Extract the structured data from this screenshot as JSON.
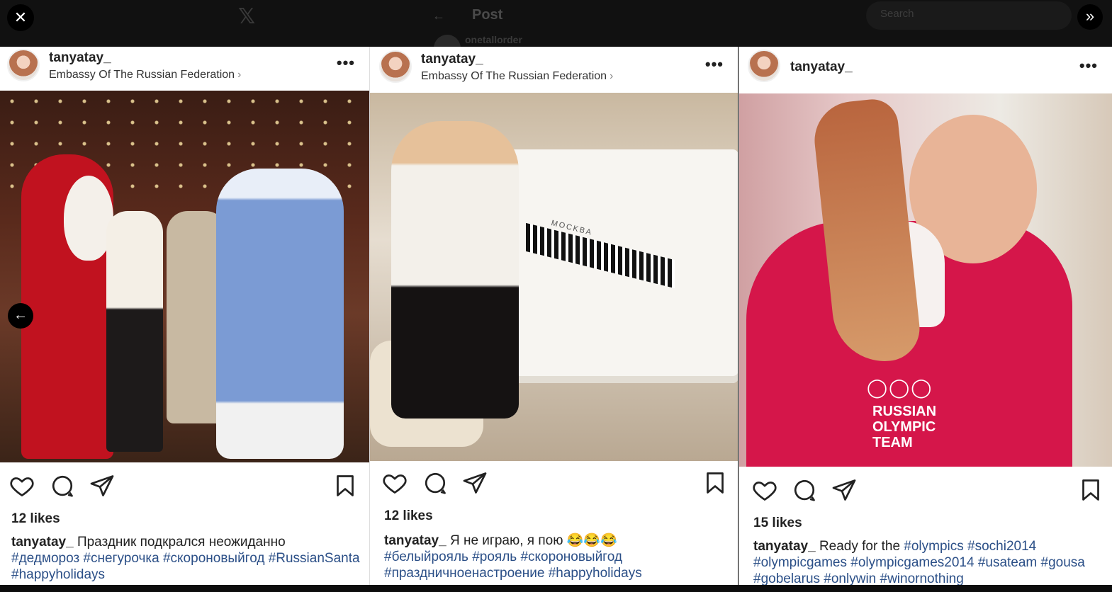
{
  "viewer": {
    "close_icon": "✕",
    "expand_icon": "»",
    "prev_icon": "←"
  },
  "background": {
    "logo": "𝕏",
    "back_icon": "←",
    "title": "Post",
    "search_placeholder": "Search",
    "user": "onetallorder"
  },
  "posts": [
    {
      "username": "tanyatay_",
      "location": "Embassy Of The Russian Federation",
      "likes": "12 likes",
      "caption_user": "tanyatay_",
      "caption_text": " Праздник подкрался неожиданно",
      "caption_tags": "#дедмороз #снегурочка #скороновыйгод #RussianSanta #happyholidays"
    },
    {
      "username": "tanyatay_",
      "location": "Embassy Of The Russian Federation",
      "likes": "12 likes",
      "caption_user": "tanyatay_",
      "caption_text": " Я не играю, я пою 😂😂😂",
      "caption_tags": "#белыйрояль #рояль #скороновыйгод #праздничноенастроение #happyholidays"
    },
    {
      "username": "tanyatay_",
      "location": "",
      "likes": "15 likes",
      "caption_user": "tanyatay_",
      "caption_text": " Ready for the ",
      "caption_tags": "#olympics #sochi2014 #olympicgames #olympicgames2014 #usateam #gousa #gobelarus #onlywin #winornothing"
    }
  ],
  "photo_text": {
    "piano_brand": "MOCKBA",
    "hoodie_line1": "RUSSIAN",
    "hoodie_line2": "OLYMPIC",
    "hoodie_line3": "TEAM"
  }
}
